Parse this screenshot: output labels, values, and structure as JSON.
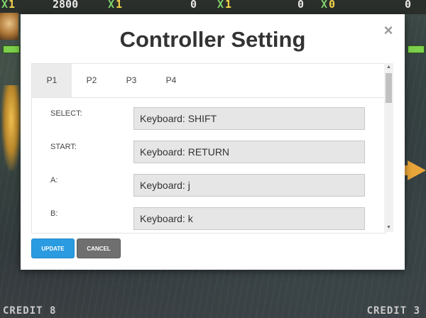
{
  "hud": {
    "p1_score": "2800",
    "p1_lives": "1",
    "p2_score": "0",
    "p2_lives": "1",
    "p3_score": "0",
    "p4_score": "0",
    "p4_lives": "0",
    "credit_left": "CREDIT 8",
    "credit_right": "CREDIT 3"
  },
  "modal": {
    "title": "Controller Setting",
    "close_label": "×",
    "tabs": [
      {
        "label": "P1",
        "active": true
      },
      {
        "label": "P2",
        "active": false
      },
      {
        "label": "P3",
        "active": false
      },
      {
        "label": "P4",
        "active": false
      }
    ],
    "bindings": [
      {
        "label": "SELECT:",
        "value": "Keyboard: SHIFT"
      },
      {
        "label": "START:",
        "value": "Keyboard: RETURN"
      },
      {
        "label": "A:",
        "value": "Keyboard: j"
      },
      {
        "label": "B:",
        "value": "Keyboard: k"
      }
    ],
    "buttons": {
      "update": "UPDATE",
      "cancel": "CANCEL"
    },
    "scroll_up": "▲",
    "scroll_down": "▼"
  },
  "colors": {
    "update_button": "#2a9be0",
    "cancel_button": "#6f6f6f",
    "active_tab": "#ebebeb",
    "input_bg": "#e6e6e6"
  }
}
